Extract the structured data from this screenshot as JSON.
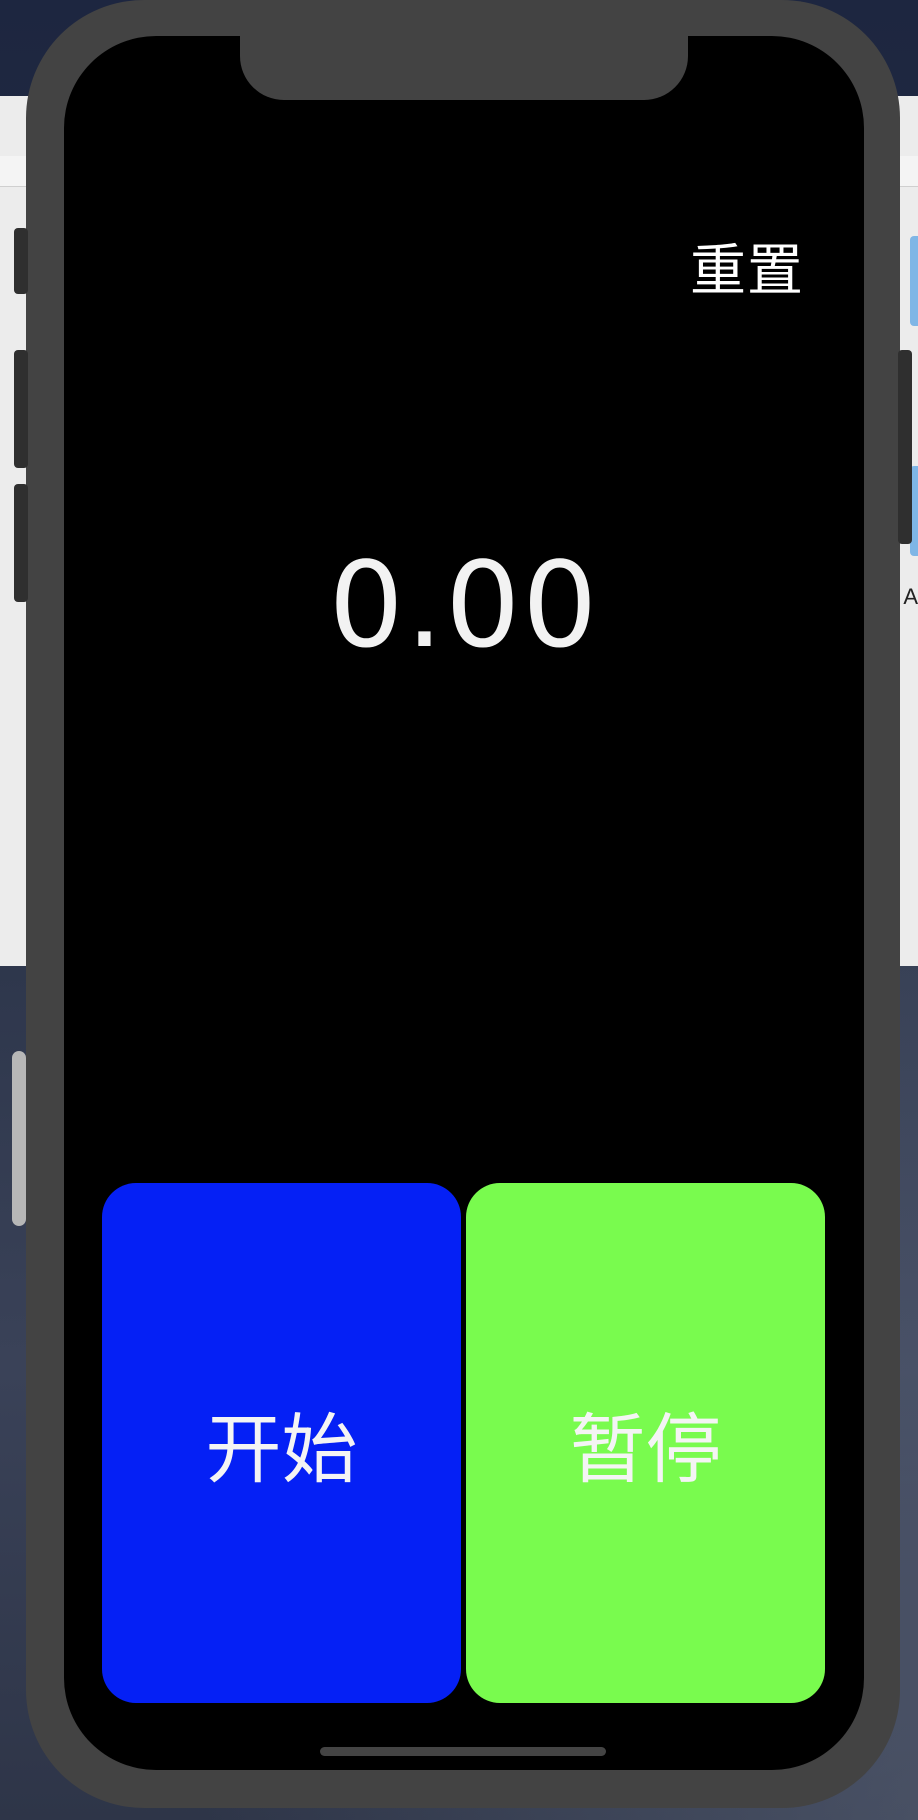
{
  "app": {
    "reset_label": "重置",
    "time_value": "0.00",
    "start_label": "开始",
    "pause_label": "暂停"
  },
  "colors": {
    "screen_background": "#000000",
    "start_button": "#0520f5",
    "pause_button": "#79fb4e",
    "text": "#ffffff",
    "device_frame": "#434343"
  },
  "desktop": {
    "peek_text": "A"
  }
}
